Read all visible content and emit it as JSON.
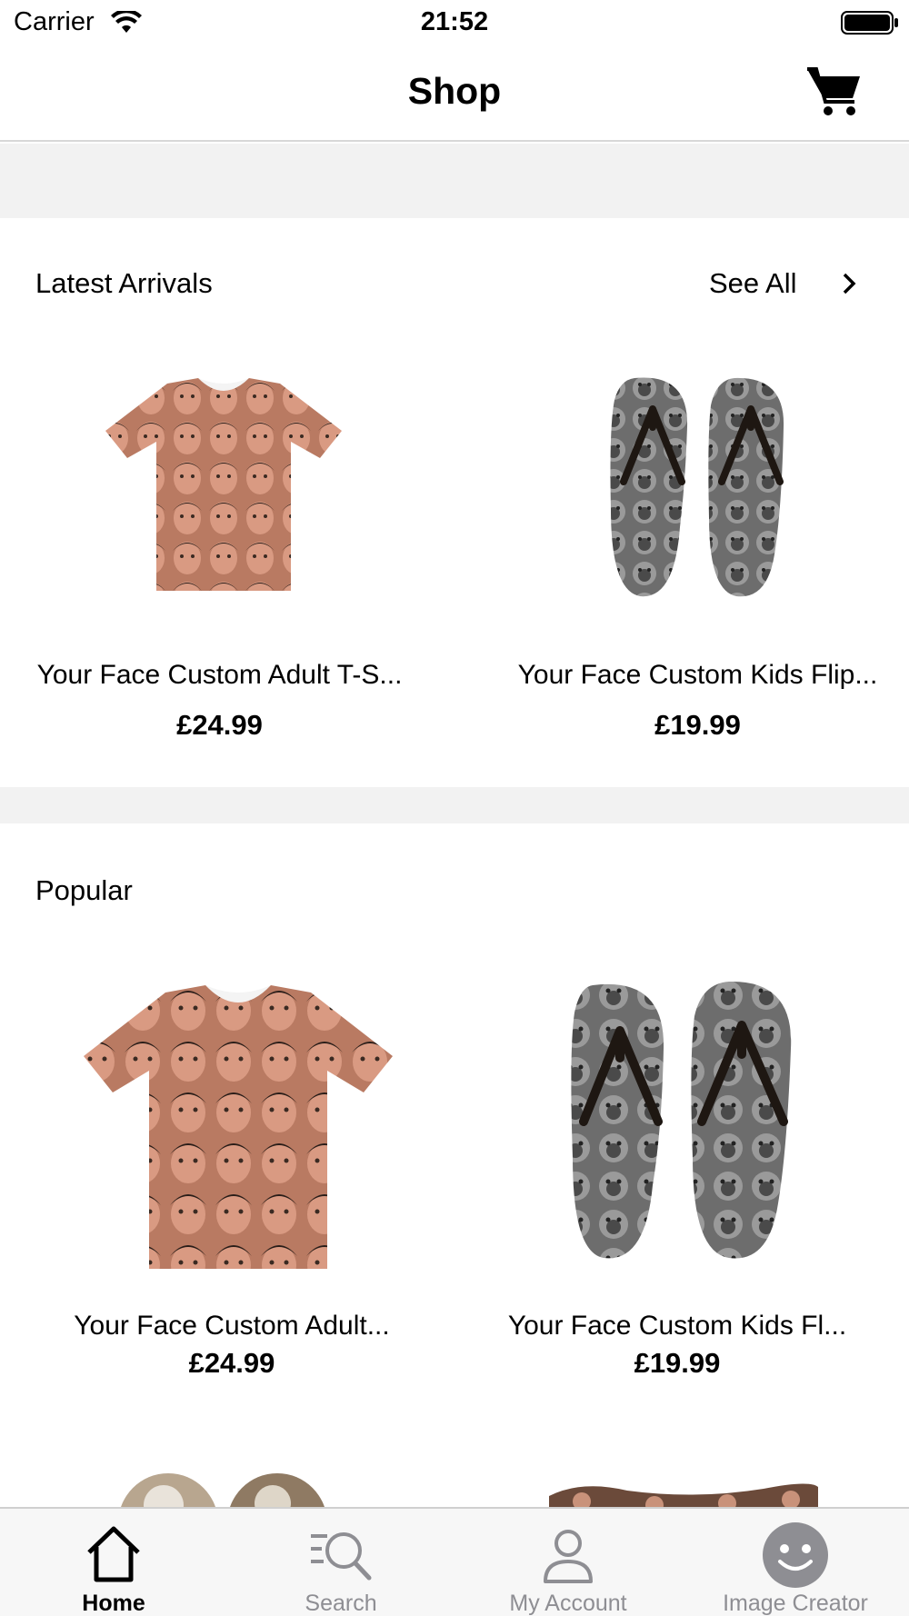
{
  "status_bar": {
    "carrier": "Carrier",
    "time": "21:52"
  },
  "nav": {
    "title": "Shop",
    "cart_icon": "cart-icon"
  },
  "sections": {
    "latest": {
      "title": "Latest Arrivals",
      "see_all_label": "See All",
      "products": [
        {
          "name": "Your Face Custom Adult T-S...",
          "price": "£24.99",
          "image": "face-tshirt"
        },
        {
          "name": "Your Face Custom Kids Flip...",
          "price": "£19.99",
          "image": "face-flipflops"
        }
      ]
    },
    "popular": {
      "title": "Popular",
      "products": [
        {
          "name": "Your Face Custom Adult...",
          "price": "£24.99",
          "image": "face-tshirt"
        },
        {
          "name": "Your Face Custom Kids Fl...",
          "price": "£19.99",
          "image": "face-flipflops"
        }
      ]
    }
  },
  "tabs": [
    {
      "label": "Home",
      "icon": "home-icon",
      "active": true
    },
    {
      "label": "Search",
      "icon": "search-icon",
      "active": false
    },
    {
      "label": "My Account",
      "icon": "person-icon",
      "active": false
    },
    {
      "label": "Image Creator",
      "icon": "smiley-icon",
      "active": false
    }
  ],
  "colors": {
    "band_gray": "#f2f2f2",
    "tab_inactive": "#8e8e93",
    "tab_active": "#000000"
  }
}
